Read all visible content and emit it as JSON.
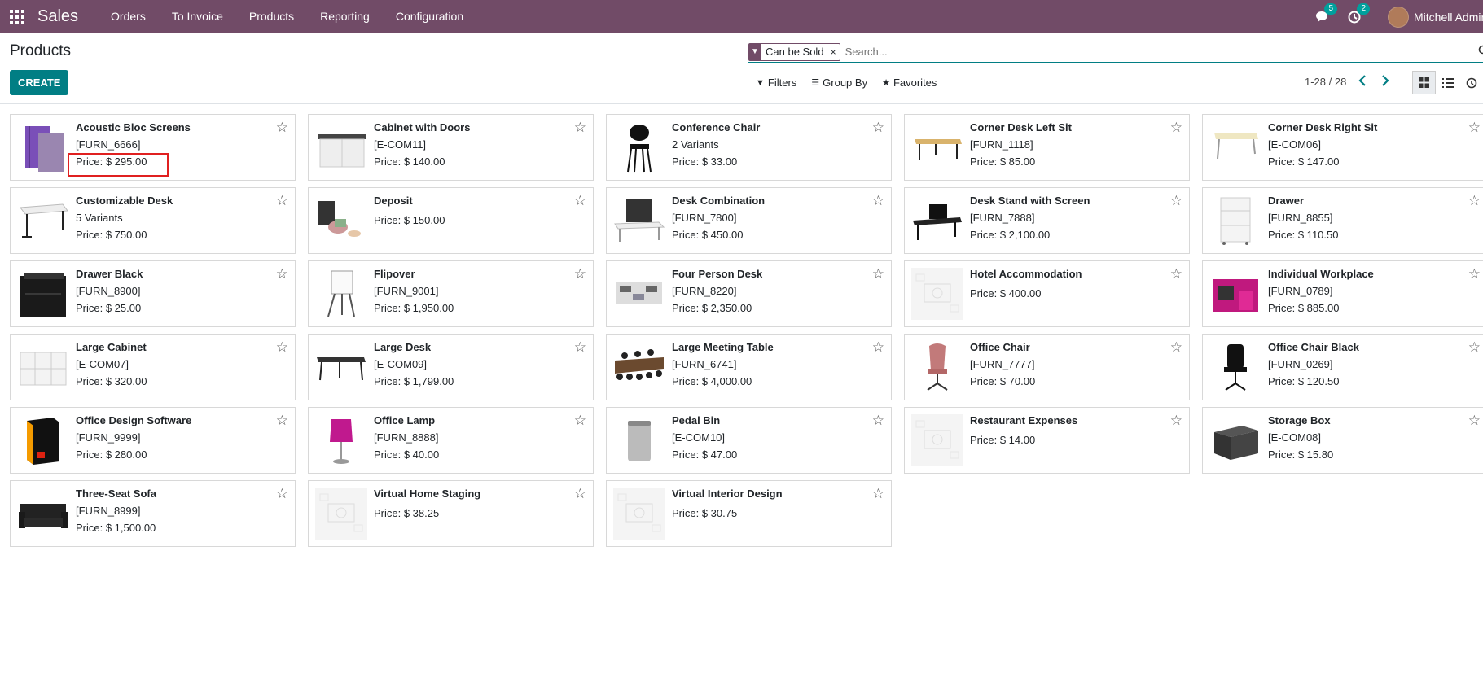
{
  "navbar": {
    "app_name": "Sales",
    "menu": [
      "Orders",
      "To Invoice",
      "Products",
      "Reporting",
      "Configuration"
    ],
    "messages_badge": "5",
    "activities_badge": "2",
    "user_name": "Mitchell Admin"
  },
  "control_panel": {
    "title": "Products",
    "create_label": "CREATE",
    "facet_label": "Can be Sold",
    "search_placeholder": "Search...",
    "filters_label": "Filters",
    "group_by_label": "Group By",
    "favorites_label": "Favorites",
    "pager": "1-28 / 28"
  },
  "products": [
    {
      "name": "Acoustic Bloc Screens",
      "ref": "[FURN_6666]",
      "price": "Price: $ 295.00",
      "img": "screens",
      "highlighted": true
    },
    {
      "name": "Cabinet with Doors",
      "ref": "[E-COM11]",
      "price": "Price: $ 140.00",
      "img": "cabinet"
    },
    {
      "name": "Conference Chair",
      "ref": "2 Variants",
      "price": "Price: $ 33.00",
      "img": "chair-black"
    },
    {
      "name": "Corner Desk Left Sit",
      "ref": "[FURN_1118]",
      "price": "Price: $ 85.00",
      "img": "desk-wood"
    },
    {
      "name": "Corner Desk Right Sit",
      "ref": "[E-COM06]",
      "price": "Price: $ 147.00",
      "img": "desk-light"
    },
    {
      "name": "Customizable Desk",
      "ref": "5 Variants",
      "price": "Price: $ 750.00",
      "img": "desk-white"
    },
    {
      "name": "Deposit",
      "ref": "",
      "price": "Price: $ 150.00",
      "img": "money"
    },
    {
      "name": "Desk Combination",
      "ref": "[FURN_7800]",
      "price": "Price: $ 450.00",
      "img": "desk-combo"
    },
    {
      "name": "Desk Stand with Screen",
      "ref": "[FURN_7888]",
      "price": "Price: $ 2,100.00",
      "img": "desk-screen"
    },
    {
      "name": "Drawer",
      "ref": "[FURN_8855]",
      "price": "Price: $ 110.50",
      "img": "drawer-white"
    },
    {
      "name": "Drawer Black",
      "ref": "[FURN_8900]",
      "price": "Price: $ 25.00",
      "img": "drawer-black"
    },
    {
      "name": "Flipover",
      "ref": "[FURN_9001]",
      "price": "Price: $ 1,950.00",
      "img": "flipover"
    },
    {
      "name": "Four Person Desk",
      "ref": "[FURN_8220]",
      "price": "Price: $ 2,350.00",
      "img": "four-desk"
    },
    {
      "name": "Hotel Accommodation",
      "ref": "",
      "price": "Price: $ 400.00",
      "img": "placeholder"
    },
    {
      "name": "Individual Workplace",
      "ref": "[FURN_0789]",
      "price": "Price: $ 885.00",
      "img": "workplace"
    },
    {
      "name": "Large Cabinet",
      "ref": "[E-COM07]",
      "price": "Price: $ 320.00",
      "img": "large-cabinet"
    },
    {
      "name": "Large Desk",
      "ref": "[E-COM09]",
      "price": "Price: $ 1,799.00",
      "img": "large-desk"
    },
    {
      "name": "Large Meeting Table",
      "ref": "[FURN_6741]",
      "price": "Price: $ 4,000.00",
      "img": "meeting-table"
    },
    {
      "name": "Office Chair",
      "ref": "[FURN_7777]",
      "price": "Price: $ 70.00",
      "img": "chair-pink"
    },
    {
      "name": "Office Chair Black",
      "ref": "[FURN_0269]",
      "price": "Price: $ 120.50",
      "img": "chair-office-black"
    },
    {
      "name": "Office Design Software",
      "ref": "[FURN_9999]",
      "price": "Price: $ 280.00",
      "img": "software"
    },
    {
      "name": "Office Lamp",
      "ref": "[FURN_8888]",
      "price": "Price: $ 40.00",
      "img": "lamp"
    },
    {
      "name": "Pedal Bin",
      "ref": "[E-COM10]",
      "price": "Price: $ 47.00",
      "img": "bin"
    },
    {
      "name": "Restaurant Expenses",
      "ref": "",
      "price": "Price: $ 14.00",
      "img": "placeholder"
    },
    {
      "name": "Storage Box",
      "ref": "[E-COM08]",
      "price": "Price: $ 15.80",
      "img": "box"
    },
    {
      "name": "Three-Seat Sofa",
      "ref": "[FURN_8999]",
      "price": "Price: $ 1,500.00",
      "img": "sofa"
    },
    {
      "name": "Virtual Home Staging",
      "ref": "",
      "price": "Price: $ 38.25",
      "img": "placeholder"
    },
    {
      "name": "Virtual Interior Design",
      "ref": "",
      "price": "Price: $ 30.75",
      "img": "placeholder"
    }
  ]
}
